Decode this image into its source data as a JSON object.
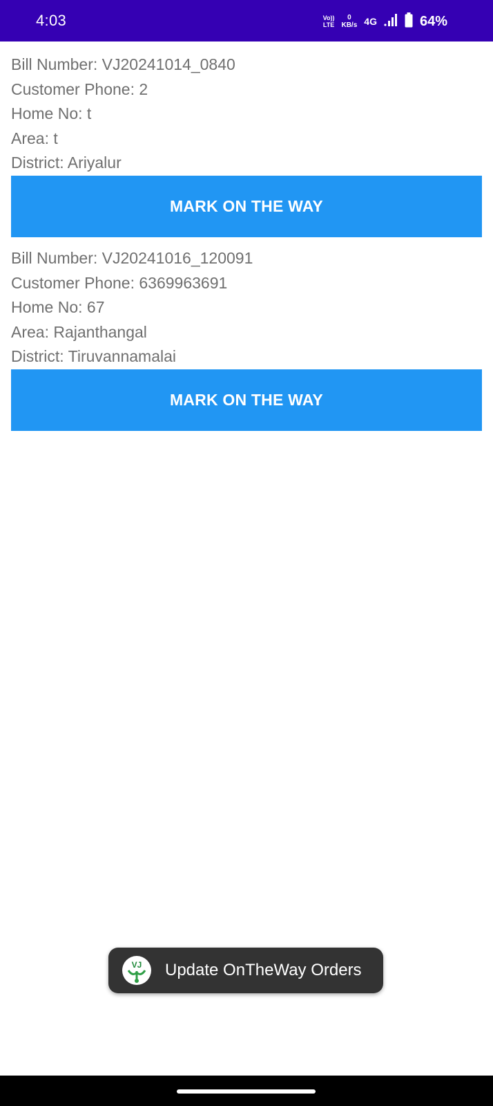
{
  "status_bar": {
    "time": "4:03",
    "volte_top": "Vo))",
    "volte_bottom": "LTE",
    "data_rate_value": "0",
    "data_rate_unit": "KB/s",
    "network": "4G",
    "battery": "64%",
    "background_color": "#3500b3"
  },
  "orders": [
    {
      "bill_number": "Bill Number: VJ20241014_0840",
      "customer_phone": "Customer Phone: 2",
      "home_no": "Home No: t",
      "area": "Area: t",
      "district": "District: Ariyalur",
      "button_label": "MARK ON THE WAY"
    },
    {
      "bill_number": "Bill Number: VJ20241016_120091",
      "customer_phone": "Customer Phone: 6369963691",
      "home_no": "Home No: 67",
      "area": "Area: Rajanthangal",
      "district": "District: Tiruvannamalai",
      "button_label": "MARK ON THE WAY"
    }
  ],
  "toast": {
    "icon": "vj-app-logo-icon",
    "logo_text": "VJ",
    "message": "Update OnTheWay Orders"
  },
  "colors": {
    "accent_button": "#2196f3",
    "text_gray": "#6f6f6f",
    "toast_background": "#333333"
  },
  "navigation": {
    "icon": "home-gesture-pill-icon"
  }
}
